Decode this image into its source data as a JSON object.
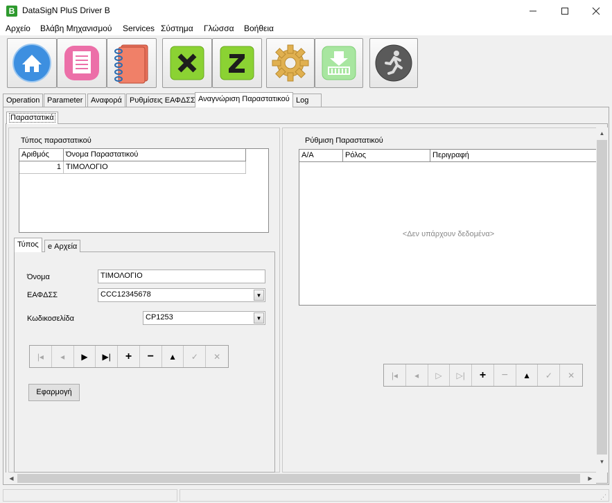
{
  "window": {
    "title": "DataSigN PluS Driver B",
    "app_icon_letter": "B"
  },
  "menu": [
    "Αρχείο",
    "Βλάβη Μηχανισμού",
    "Services",
    "Σύστημα",
    "Γλώσσα",
    "Βοήθεια"
  ],
  "toolbar": {
    "buttons": [
      "home-icon",
      "notepad-icon",
      "notebook-icon",
      "x-report-icon",
      "z-report-icon",
      "settings-gear-icon",
      "download-receipt-icon",
      "run-icon"
    ]
  },
  "tabs": [
    "Operation",
    "Parameter",
    "Αναφορά",
    "Ρυθμίσεις ΕΑΦΔΣΣ",
    "Αναγνώριση Παραστατικού",
    "Log"
  ],
  "active_tab": "Αναγνώριση Παραστατικού",
  "subtab": "Παραστατικά",
  "left": {
    "group_title": "Τύπος παραστατικού",
    "grid": {
      "columns": [
        "Αριθμός",
        "Όνομα Παραστατικού"
      ],
      "rows": [
        {
          "num": "1",
          "name": "ΤΙΜΟΛΟΓΙΟ"
        }
      ]
    },
    "inner_tabs": [
      "Τύπος",
      "e Αρχεία"
    ],
    "form": {
      "name_label": "Όνομα",
      "name_value": "ΤΙΜΟΛΟΓΙΟ",
      "eafdss_label": "ΕΑΦΔΣΣ",
      "eafdss_value": "CCC12345678",
      "codepage_label": "Κωδικοσελίδα",
      "codepage_value": "CP1253"
    },
    "apply_button": "Εφαρμογή"
  },
  "right": {
    "group_title": "Ρύθμιση Παραστατικού",
    "grid": {
      "columns": [
        "Α/Α",
        "Ρόλος",
        "Περιγραφή"
      ],
      "empty_text": "<Δεν υπάρχουν δεδομένα>"
    }
  },
  "colors": {
    "accent_green": "#2e9a2e",
    "home_blue": "#3d8fe0",
    "x_green": "#8bd233",
    "gear_orange": "#e0b050"
  }
}
